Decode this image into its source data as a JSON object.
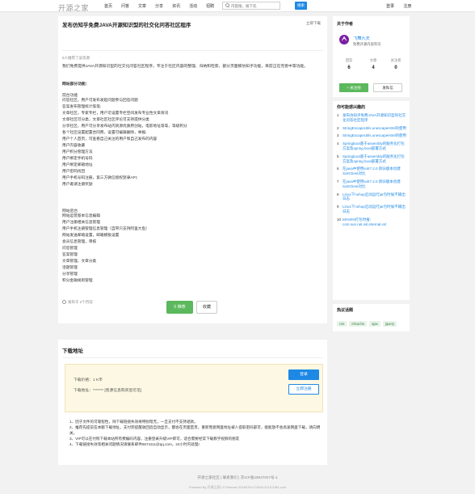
{
  "header": {
    "logo": "开源之家",
    "nav": [
      "首页",
      "问答",
      "文章",
      "分享",
      "资讯",
      "活动",
      "招聘"
    ],
    "search_placeholder": "内容搜，搜下先",
    "search_button": "搜索",
    "login": "登录",
    "register": "注册"
  },
  "article": {
    "title": "发布仿知乎免费JAVA开源知识型的社交化问答社区程序",
    "share_top": "立即下载",
    "meta": "5人推荐了该资源",
    "intro": "我们免费提供JAVA开源知识型的社交化问答社区程序，专注于社区内容的整理、归纳和检索，部分页面模仿知乎功能，目前正在完善中等功能。",
    "section_label": "网站部分功能：",
    "front_label": "前台功能",
    "front_items": [
      "问答社区，用户可发布发起问题参与回答问题",
      "答案发布管理统计等等;",
      "文章社区，专家专栏，用户可设置专栏空间发布专业性文章资讯",
      "文章社区可分类，文章社区社区评论可支持提供分类",
      "分享社区，用户可分享发布站内资源优质原创站，电影地址等等，等级积分",
      "各个社区设置配置合同费，设置可编辑删除，举报;",
      "用户个人首页，可查看自己关注的用户和自己发布的内容",
      "用户内容收藏",
      "用户积分管理方法",
      "用户绑定手机号码",
      "用户绑定邮箱地址",
      "用户密码找回",
      "用户手机号码注册，第三方微信授权登录API;",
      "用户邀请注册奖励"
    ],
    "back_label": "网站后台",
    "back_items": [
      "网站运营基本信息编辑",
      "用户注册相关信息管理",
      "用户手机注册管理信息管理（自带只支持阿里大鱼）",
      "网站发送邮箱设置，邮箱模板设置",
      "会员信息管理，审核",
      "问答管理",
      "答案管理",
      "文章管理，文章分类",
      "话题管理",
      "分享管理",
      "积分金融规则管理"
    ],
    "posted": "发布于 2个月前",
    "recommend_button": "0 推荐",
    "favorite_button": "收藏"
  },
  "download": {
    "title": "下载地址",
    "price": "下载价格：1 K币",
    "address": "下载地址：******* [售源信息购买后可见]",
    "login_button": "登录",
    "register_button": "立即注册",
    "notes": [
      "1、因于文件的可靠程性，除下载链接失效将特别暗无，一旦支付不支持退款。",
      "2、推荐先提前在本额下载地址，支付完提醒收回后自动显示，都会在页面首页，重新而意网盘地址被人提取密码部可，能能放不会高速网盘下载，请向明关。",
      "3、VIP可以在付购下载本站所有费编码内容，注册登录升级VIP即可，适合需要经常下载教学视频的朋友",
      "4、下载链接失效等相关问题情况请联系邮件5674111@qq.com，24小时内处理!"
    ]
  },
  "author": {
    "section_title": "关于作者",
    "avatar_letter": "ᗅ",
    "name": "飞舞九天",
    "desc": "免费开源内容资讯",
    "stats": [
      {
        "label": "回答",
        "value": "6"
      },
      {
        "label": "文章",
        "value": "4"
      },
      {
        "label": "关注者",
        "value": "0"
      }
    ],
    "follow_button": "+ 关注他",
    "message_button": "发私信"
  },
  "related": {
    "section_title": "你可能感兴趣的",
    "items": [
      "发布仿知乎免费JAVA开源知识型的社交化问答社区程序",
      "StringEscapeUtils.unescapeHtml的使用",
      "StringEscapeUtils.unescapeHtml的使用",
      "Springboot基于assembly的服务化打包方案及spring boot部署方式",
      "Springboot基于assembly的服务化打包方案及spring boot部署方式",
      "在java中使用solr7.2.0 新旧版本创建SolrClient对比",
      "在java中使用solr7.2.0 新旧版本创建SolrClient对比",
      "Linux下nohup启动运行jar包时候不输出日志",
      "Linux下nohup启动运行jar包时候不输出日志",
      "MAVEN打包时报：com.sun.net.ssl.internal.ssl"
    ]
  },
  "tags": {
    "section_title": "热议话题",
    "items": [
      "css",
      "ehcache",
      "ajax",
      "jquery"
    ]
  },
  "footer": {
    "line1": "开源之家社区  |  联系我们  |  京ICP备18047027号-1",
    "line2": "Powered By 开源之家1.0 Release 20180704 ©2008-2018 ZIB4.com"
  },
  "colors": {
    "accent": "#1e88e5",
    "success": "#5cb85c",
    "notice_bg": "#fcf8e3"
  }
}
